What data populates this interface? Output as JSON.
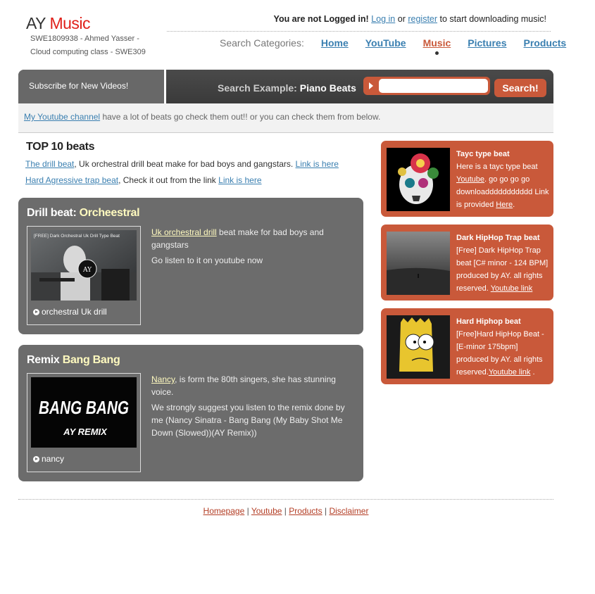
{
  "header": {
    "logo_ay": "AY",
    "logo_music": "Music",
    "subtitle_line1": "SWE1809938 - Ahmed Yasser -",
    "subtitle_line2": "Cloud computing class - SWE309",
    "login_prefix": "You are not Logged in!",
    "login_link": "Log in",
    "login_or": "or",
    "register_link": "register",
    "login_suffix": "to start downloading music!"
  },
  "nav": {
    "label": "Search Categories:",
    "items": [
      "Home",
      "YouTube",
      "Music",
      "Pictures",
      "Products"
    ],
    "active": "Music"
  },
  "searchbar": {
    "subscribe": "Subscribe for New Videos!",
    "example_label": "Search Example:",
    "example_value": "Piano Beats",
    "input_value": "",
    "button": "Search!"
  },
  "notice": {
    "link": "My Youtube channel",
    "text": "have a lot of beats go check them out!! or you can check them from below."
  },
  "top10": {
    "title": "TOP 10 beats",
    "line1_link": "The drill beat",
    "line1_text": ", Uk orchestral drill beat make for bad boys and gangstars.",
    "line1_link2": "Link is here",
    "line2_link": "Hard Agressive trap beat",
    "line2_text": ", Check it out from the link",
    "line2_link2": "Link is here"
  },
  "box1": {
    "title_plain": "Drill beat:",
    "title_hl": "Orcheestral",
    "thumb_overlay": "[FREE] Dark Orchestral Uk Drill Type Beat",
    "thumb_badge": "AY",
    "caption": "orchestral Uk drill",
    "desc_link": "Uk orchestral drill",
    "desc_text": "beat make for bad boys and gangstars",
    "desc_p2": "Go listen to it on youtube now"
  },
  "box2": {
    "title_plain": "Remix",
    "title_hl": "Bang Bang",
    "thumb_title": "BANG BANG",
    "thumb_sub": "AY REMIX",
    "caption": "nancy",
    "desc_link": "Nancy",
    "desc_text": ", is form the 80th singers, she has stunning voice.",
    "desc_p2": "We strongly suggest you listen to the remix done by me (Nancy Sinatra - Bang Bang (My Baby Shot Me Down (Slowed))(AY Remix))"
  },
  "cards": [
    {
      "title": "Tayc type beat",
      "text1": "Here is a tayc type beat",
      "link1": "Youtube",
      "text2": ". go go go go downloaddddddddddd Link is provided",
      "link2": "Here",
      "text3": "."
    },
    {
      "title": "Dark HipHop Trap beat",
      "text1": "[Free] Dark HipHop Trap beat [C# minor - 124 BPM] produced by AY. all rights reserved.",
      "link1": "Youtube link"
    },
    {
      "title": "Hard Hiphop beat",
      "text1": "[Free]Hard HipHop Beat - [E-minor 175bpm] produced by AY. all rights reserved.",
      "link1": "Youtube link",
      "text2": "."
    }
  ],
  "footer": {
    "links": [
      "Homepage",
      "Youtube",
      "Products",
      "Disclaimer"
    ],
    "separator": "|"
  }
}
